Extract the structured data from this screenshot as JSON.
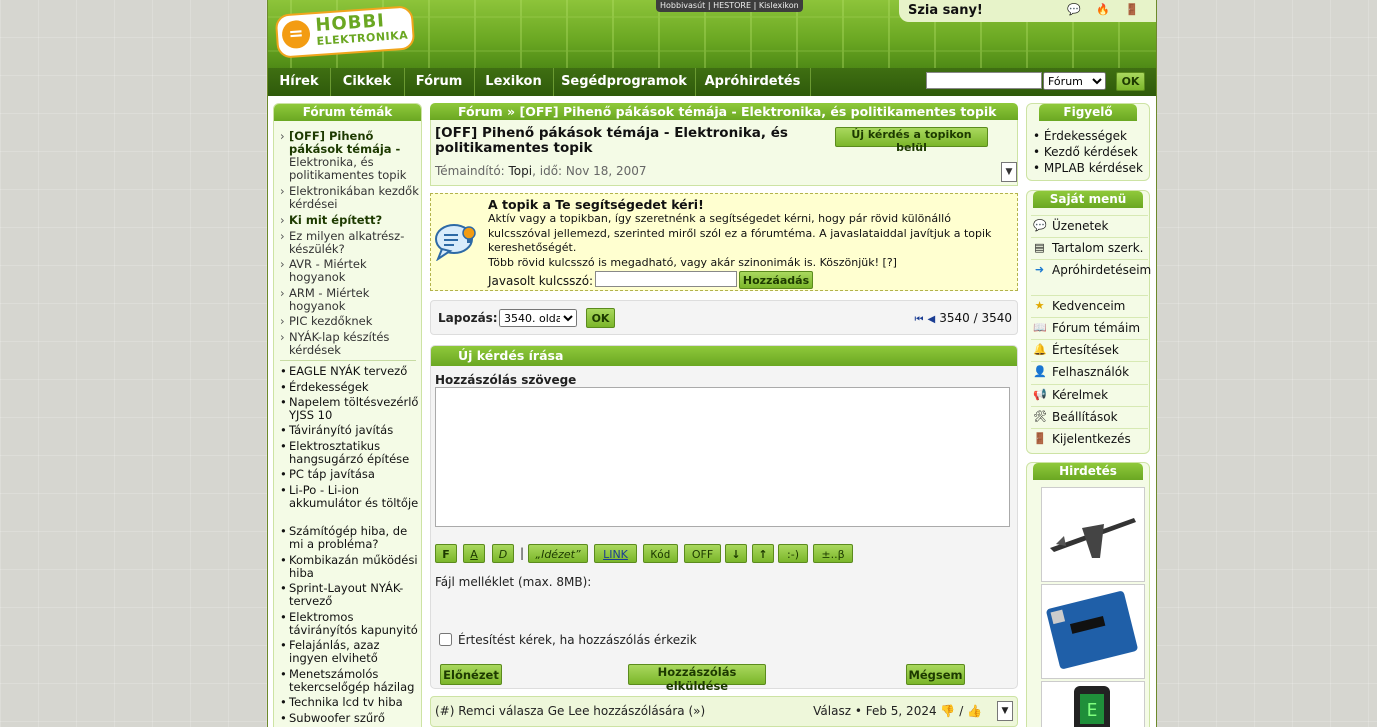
{
  "header": {
    "logo_top": "HOBBI",
    "logo_bottom": "ELEKTRONIKA",
    "toplinks": [
      "Hobbivasút",
      "HESTORE",
      "Kislexikon"
    ],
    "greeting": "Szia sany!"
  },
  "nav": {
    "items": [
      "Hírek",
      "Cikkek",
      "Fórum",
      "Lexikon",
      "Segédprogramok",
      "Apróhirdetés"
    ],
    "search_value": "",
    "search_scope": "Fórum",
    "ok_label": "OK"
  },
  "left": {
    "title": "Fórum témák",
    "topics": [
      {
        "prefix": "[OFF] Pihenő pákások témája -",
        "rest": " Elektronika, és politikamentes topik"
      },
      {
        "text": "Elektronikában kezdők kérdései"
      },
      {
        "text": "Ki mit épített?"
      },
      {
        "text": "Ez milyen alkatrész-készülék?"
      },
      {
        "text": "AVR - Miértek hogyanok"
      },
      {
        "text": "ARM - Miértek hogyanok"
      },
      {
        "text": "PIC kezdőknek"
      },
      {
        "text": "NYÁK-lap készítés kérdések"
      }
    ],
    "recent": [
      "EAGLE NYÁK tervező",
      "Érdekességek",
      "Napelem töltésvezérlő YJSS 10",
      "Távirányító javítás",
      "Elektrosztatikus hangsugárzó építése",
      "PC táp javítása",
      "Li-Po - Li-ion akkumulátor és töltője",
      "Számítógép hiba, de mi a probléma?",
      "Kombikazán működési hiba",
      "Sprint-Layout NYÁK-tervező",
      "Elektromos távirányítós kapunyitó",
      "Felajánlás, azaz ingyen elvihető",
      "Menetszámolós tekercselőgép házilag",
      "Technika lcd tv hiba",
      "Subwoofer szűrő"
    ]
  },
  "main": {
    "breadcrumb": "Fórum » [OFF] Pihenő pákások témája - Elektronika, és politikamentes topik",
    "topic_title": "[OFF] Pihenő pákások témája - Elektronika, és politikamentes topik",
    "new_question_btn": "Új kérdés a topikon belül",
    "meta_label": "Témaindító: ",
    "meta_author": "Topi",
    "meta_date": ", idő: Nov 18, 2007",
    "help": {
      "heading": "A topik a Te segítségedet kéri!",
      "text1": "Aktív vagy a topikban, így szeretnénk a segítségedet kérni, hogy pár rövid különálló kulcsszóval jellemezd, szerinted miről szól ez a fórumtéma. A javaslataiddal javítjuk a topik kereshetőségét.",
      "text2": "Több rövid kulcsszó is megadható, vagy akár szinonimák is. Köszönjük! [?]",
      "keyword_label": "Javasolt kulcsszó:",
      "add_btn": "Hozzáadás"
    },
    "pager": {
      "label": "Lapozás:",
      "page_select": "3540. oldal",
      "ok": "OK",
      "count": "3540 / 3540"
    },
    "newq": {
      "title": "Új kérdés írása",
      "text_label": "Hozzászólás szövege",
      "toolbar": [
        "F",
        "A",
        "D",
        "|",
        "„Idézet”",
        "LINK",
        "Kód",
        "OFF",
        "↓",
        "↑",
        ":-)",
        "±..β"
      ],
      "file_label": "Fájl melléklet (max. 8MB):",
      "notify_label": "Értesítést kérek, ha hozzászólás érkezik",
      "preview_btn": "Előnézet",
      "submit_btn": "Hozzászólás elküldése",
      "cancel_btn": "Mégsem"
    },
    "reply": {
      "left": "(#) Remci válasza Ge Lee hozzászólására (»)",
      "right": "Válasz • Feb 5, 2024 ",
      "right_sep": " / "
    }
  },
  "right": {
    "watch_title": "Figyelő",
    "watch": [
      "Érdekességek",
      "Kezdő kérdések",
      "MPLAB kérdések"
    ],
    "menu_title": "Saját menü",
    "menu": [
      "Üzenetek",
      "Tartalom szerk.",
      "Apróhirdetéseim",
      "Kedvenceim",
      "Fórum témáim",
      "Értesítések",
      "Felhasználók",
      "Kérelmek",
      "Beállítások",
      "Kijelentkezés"
    ],
    "ads_title": "Hirdetés"
  },
  "colors": {
    "brand_green": "#6aa722",
    "nav_dark": "#2f5a0b",
    "help_bg": "#ffffd0"
  }
}
